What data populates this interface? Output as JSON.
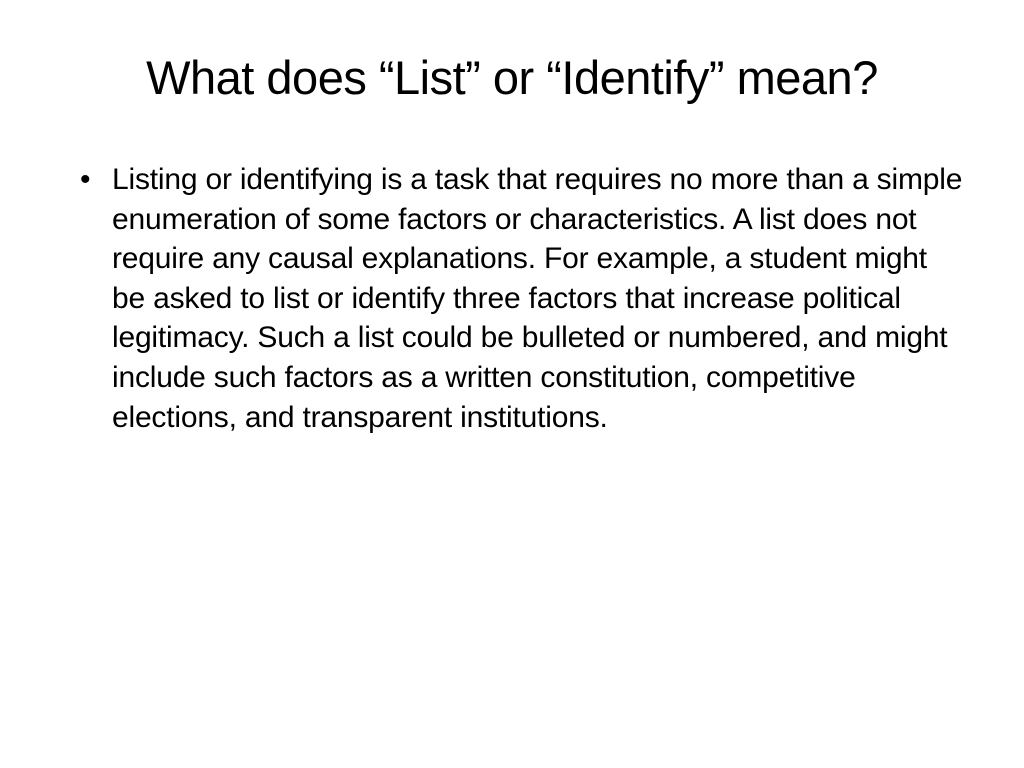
{
  "slide": {
    "title": "What does “List” or “Identify” mean?",
    "bullets": [
      "Listing or identifying is a task that requires no more than a simple enumeration of some factors or characteristics. A list does not require any causal explanations. For example, a student might be asked to list or identify three factors that increase political legitimacy. Such a list could be bulleted or numbered, and might include such factors as a written constitution, competitive elections, and transparent institutions."
    ]
  }
}
